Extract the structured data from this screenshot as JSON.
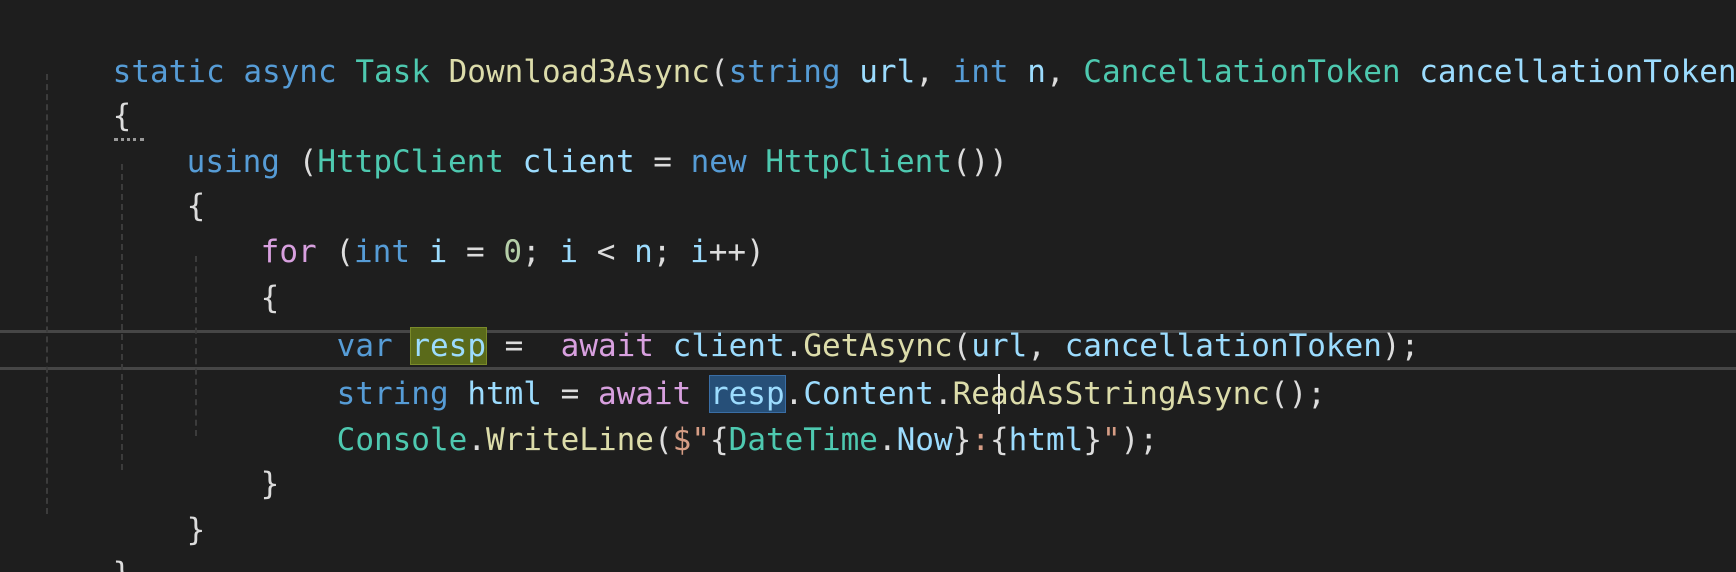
{
  "window": {
    "app": "Code Editor"
  },
  "code": {
    "l1": {
      "static": "static",
      "async": "async",
      "task": "Task",
      "method": "Download3Async",
      "open": "(",
      "string": "string",
      "url": "url",
      "c1": ",",
      "int": "int",
      "n": "n",
      "c2": ",",
      "ctype": "CancellationToken",
      "ctoken": "cancellationToken",
      "close": ")"
    },
    "l2": {
      "brace": "{"
    },
    "l3": {
      "using": "using",
      "open": "(",
      "htype": "HttpClient",
      "client": "client",
      "eq": "=",
      "new": "new",
      "htype2": "HttpClient",
      "call": "())"
    },
    "l4": {
      "brace": "{"
    },
    "l5": {
      "for": "for",
      "open": "(",
      "int": "int",
      "i": "i",
      "eq": "=",
      "zero": "0",
      "semi1": ";",
      "i2": "i",
      "lt": "<",
      "n": "n",
      "semi2": ";",
      "i3": "i",
      "inc": "++",
      "close": ")"
    },
    "l6": {
      "brace": "{"
    },
    "l7": {
      "var": "var",
      "resp": "resp",
      "eq": "=",
      "await": "await",
      "client": "client",
      "dot": ".",
      "getasync": "GetAsync",
      "open": "(",
      "url": "url",
      "comma": ",",
      "ctoken": "cancellationToken",
      "close": ");"
    },
    "l8": {
      "string": "string",
      "html": "html",
      "eq": "=",
      "await": "await",
      "resp": "resp",
      "dot1": ".",
      "content": "Content",
      "dot2": ".",
      "read": "ReadAsStringAsync",
      "close": "();"
    },
    "l9": {
      "console": "Console",
      "dot": ".",
      "writeline": "WriteLine",
      "open": "(",
      "dollar": "$",
      "q1": "\"",
      "b1": "{",
      "datetime": "DateTime",
      "dot2": ".",
      "now": "Now",
      "b2": "}",
      "colon": ":",
      "b3": "{",
      "html": "html",
      "b4": "}",
      "q2": "\"",
      "close": ");"
    },
    "l10": {
      "brace": "}"
    },
    "l11": {
      "brace": "}"
    },
    "l12": {
      "brace": "}"
    }
  },
  "colors": {
    "background": "#1e1e1e",
    "keyword": "#569cd6",
    "type": "#4ec9b0",
    "method": "#dcdcaa",
    "variable": "#9cdcfe",
    "control": "#d8a0df",
    "number": "#b5cea8",
    "string": "#d69d85",
    "write-highlight": "#5a6a1a",
    "read-highlight": "#264f78"
  }
}
